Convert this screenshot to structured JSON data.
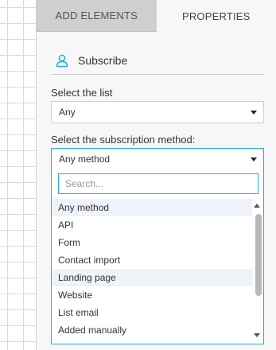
{
  "tabs": [
    {
      "label": "ADD ELEMENTS",
      "active": false
    },
    {
      "label": "PROPERTIES",
      "active": true
    }
  ],
  "section": {
    "title": "Subscribe",
    "icon": "user-icon"
  },
  "list_field": {
    "label": "Select the list",
    "value": "Any"
  },
  "method_field": {
    "label": "Select the subscription method:",
    "value": "Any method",
    "search_placeholder": "Search...",
    "options": [
      "Any method",
      "API",
      "Form",
      "Contact import",
      "Landing page",
      "Website",
      "List email",
      "Added manually"
    ]
  },
  "colors": {
    "accent": "#22b3c9",
    "highlight": "#eef3fa"
  }
}
